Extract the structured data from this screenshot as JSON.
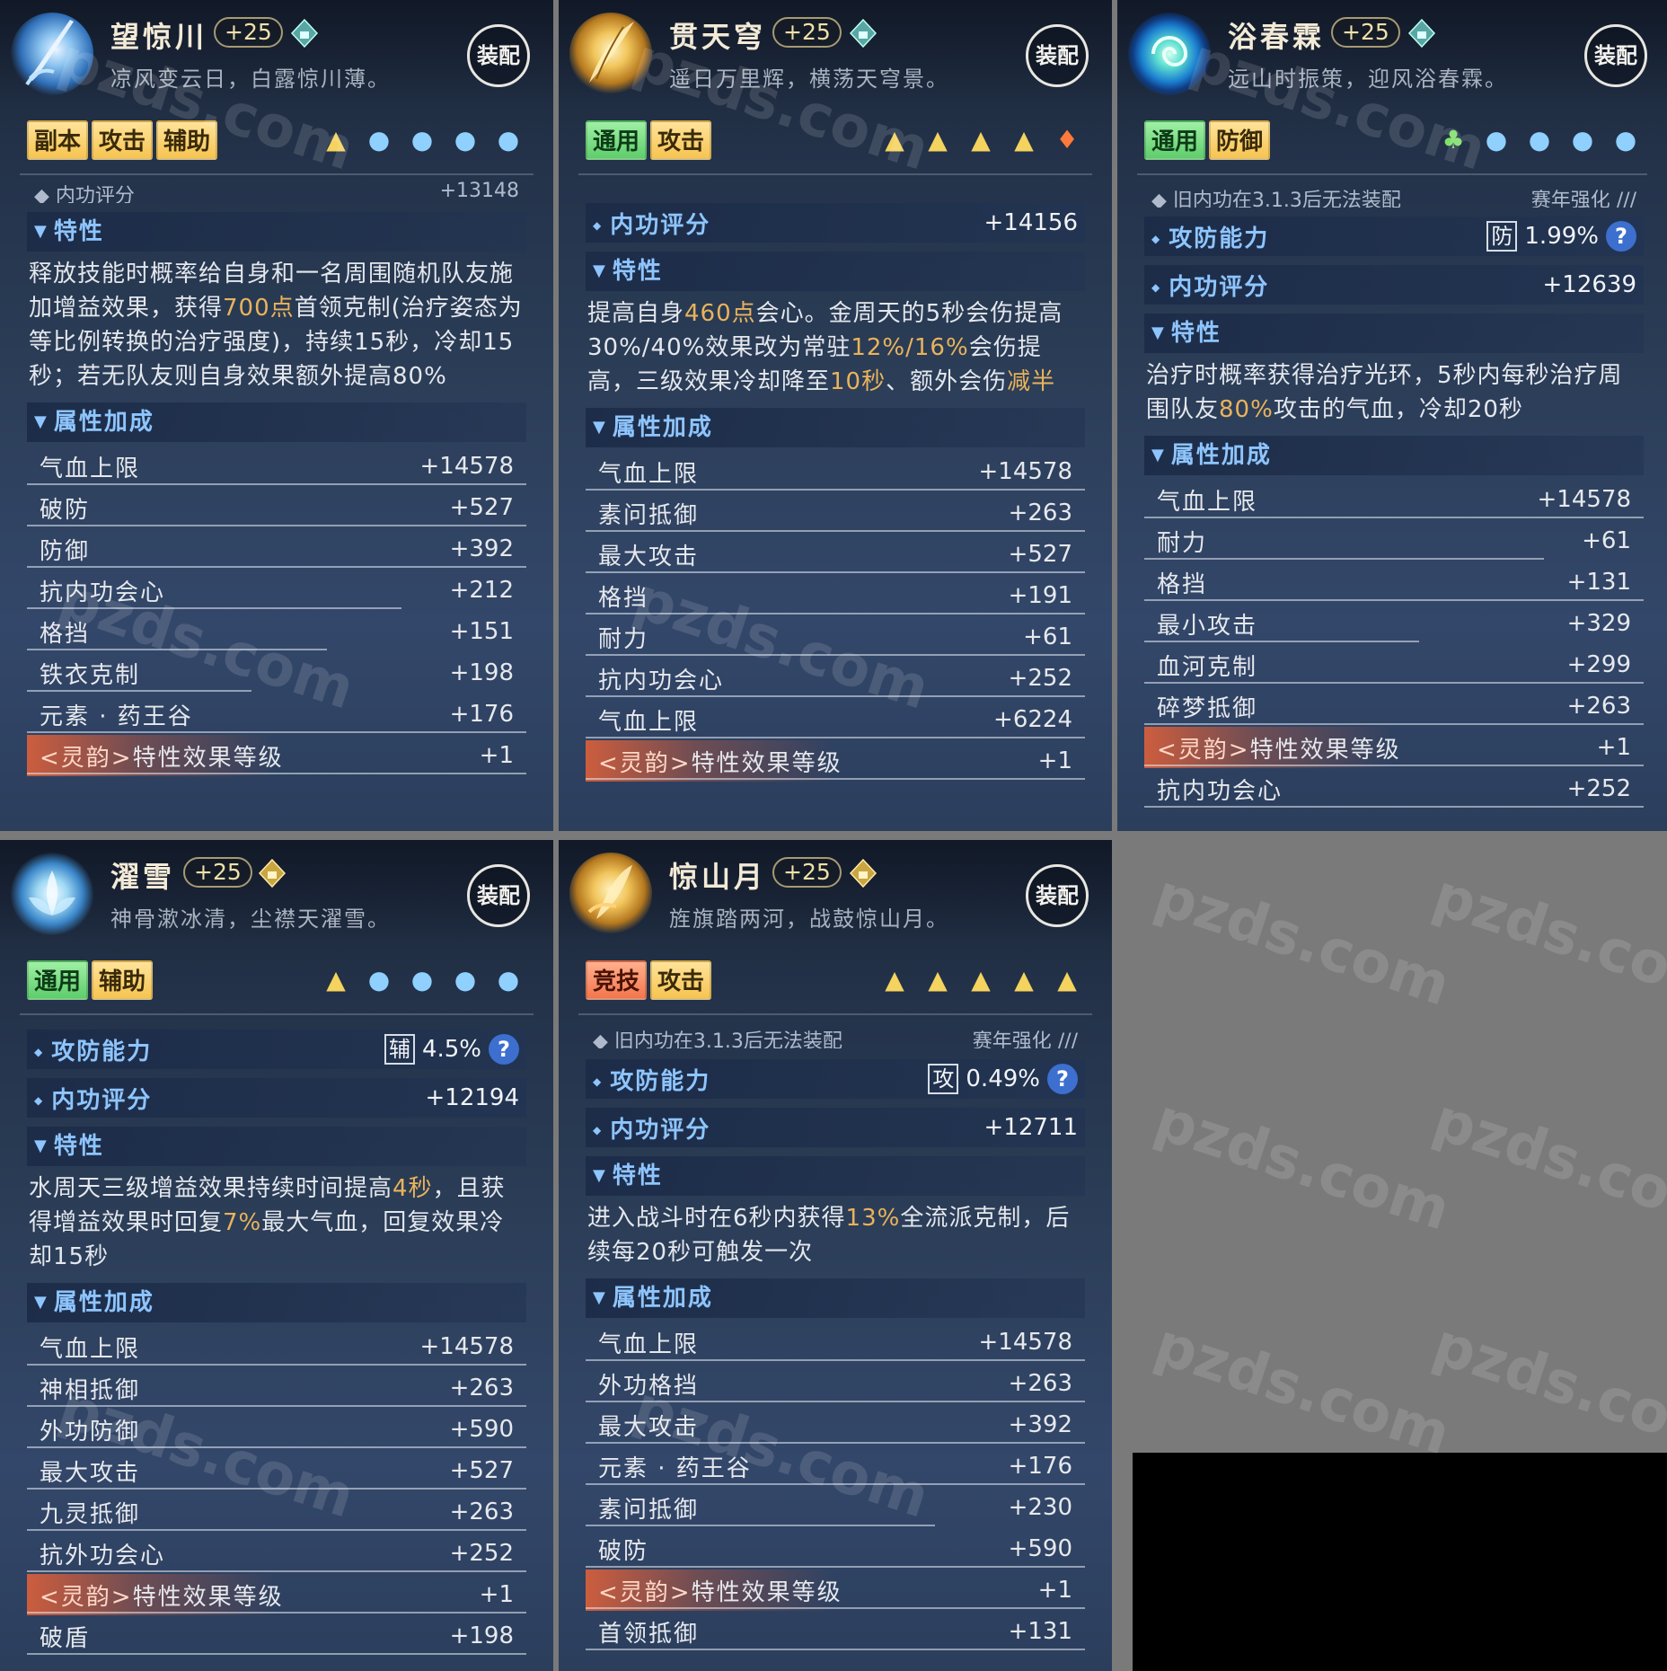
{
  "watermark": "pzds.com",
  "panels": [
    {
      "name": "望惊川",
      "level": "+25",
      "motto": "凉风变云日，白露惊川薄。",
      "equip": "装配",
      "tags": [
        "副本",
        "攻击",
        "辅助"
      ],
      "cut_left": "◆ 内功评分",
      "cut_right": "+13148",
      "trait_title": "特性",
      "desc": [
        "释放技能时概率给自身和一名周围随机队友施加增益效果，获得",
        "700点",
        "首领克制(治疗姿态为等比例转换的治疗强度)，持续15秒，冷却15秒；若无队友则自身效果额外提高80%"
      ],
      "attr_title": "属性加成",
      "stats": [
        {
          "k": "气血上限",
          "v": "+14578"
        },
        {
          "k": "破防",
          "v": "+527"
        },
        {
          "k": "防御",
          "v": "+392"
        },
        {
          "k": "抗内功会心",
          "v": "+212"
        },
        {
          "k": "格挡",
          "v": "+151"
        },
        {
          "k": "铁衣克制",
          "v": "+198"
        },
        {
          "k": "元素 · 药王谷",
          "v": "+176"
        },
        {
          "k": "<灵韵>特性效果等级",
          "lt": "<灵韵>",
          "rest": "特性效果等级",
          "v": "+1"
        }
      ]
    },
    {
      "name": "贯天穹",
      "level": "+25",
      "motto": "遥日万里辉，横荡天穹景。",
      "equip": "装配",
      "tags": [
        "通用",
        "攻击"
      ],
      "score_label": "内功评分",
      "score_value": "+14156",
      "trait_title": "特性",
      "desc": [
        "提高自身",
        "460点",
        "会心。金周天的5秒会伤提高30%/40%效果改为常驻",
        "12%/16%",
        "会伤提高，三级效果冷却降至",
        "10秒",
        "、额外会伤",
        "减半"
      ],
      "attr_title": "属性加成",
      "stats": [
        {
          "k": "气血上限",
          "v": "+14578"
        },
        {
          "k": "素问抵御",
          "v": "+263"
        },
        {
          "k": "最大攻击",
          "v": "+527"
        },
        {
          "k": "格挡",
          "v": "+191"
        },
        {
          "k": "耐力",
          "v": "+61"
        },
        {
          "k": "抗内功会心",
          "v": "+252"
        },
        {
          "k": "气血上限",
          "v": "+6224"
        },
        {
          "lt": "<灵韵>",
          "rest": "特性效果等级",
          "v": "+1"
        }
      ]
    },
    {
      "name": "浴春霖",
      "level": "+25",
      "motto": "远山时振策，迎风浴春霖。",
      "equip": "装配",
      "tags": [
        "通用",
        "防御"
      ],
      "cut_left": "◆ 旧内功在3.1.3后无法装配",
      "cut_right": "赛年强化 ///",
      "power_label": "攻防能力",
      "power_badge": "防",
      "power_value": "1.99%",
      "score_label": "内功评分",
      "score_value": "+12639",
      "trait_title": "特性",
      "desc": [
        "治疗时概率获得治疗光环，5秒内每秒治疗周围队友",
        "80%",
        "攻击的气血，冷却20秒"
      ],
      "attr_title": "属性加成",
      "stats": [
        {
          "k": "气血上限",
          "v": "+14578"
        },
        {
          "k": "耐力",
          "v": "+61"
        },
        {
          "k": "格挡",
          "v": "+131"
        },
        {
          "k": "最小攻击",
          "v": "+329"
        },
        {
          "k": "血河克制",
          "v": "+299"
        },
        {
          "k": "碎梦抵御",
          "v": "+263"
        },
        {
          "lt": "<灵韵>",
          "rest": "特性效果等级",
          "v": "+1"
        },
        {
          "k": "抗内功会心",
          "v": "+252"
        }
      ]
    },
    {
      "name": "濯雪",
      "level": "+25",
      "motto": "神骨漱冰清，尘襟天濯雪。",
      "equip": "装配",
      "tags": [
        "通用",
        "辅助"
      ],
      "power_label": "攻防能力",
      "power_badge": "辅",
      "power_value": "4.5%",
      "score_label": "内功评分",
      "score_value": "+12194",
      "trait_title": "特性",
      "desc": [
        "水周天三级增益效果持续时间提高",
        "4秒",
        "，且获得增益效果时回复",
        "7%",
        "最大气血，回复效果冷却15秒"
      ],
      "attr_title": "属性加成",
      "stats": [
        {
          "k": "气血上限",
          "v": "+14578"
        },
        {
          "k": "神相抵御",
          "v": "+263"
        },
        {
          "k": "外功防御",
          "v": "+590"
        },
        {
          "k": "最大攻击",
          "v": "+527"
        },
        {
          "k": "九灵抵御",
          "v": "+263"
        },
        {
          "k": "抗外功会心",
          "v": "+252"
        },
        {
          "lt": "<灵韵>",
          "rest": "特性效果等级",
          "v": "+1"
        },
        {
          "k": "破盾",
          "v": "+198"
        }
      ]
    },
    {
      "name": "惊山月",
      "level": "+25",
      "motto": "旌旗踏两河，战鼓惊山月。",
      "equip": "装配",
      "tags": [
        "竞技",
        "攻击"
      ],
      "cut_left": "◆ 旧内功在3.1.3后无法装配",
      "cut_right": "赛年强化 ///",
      "power_label": "攻防能力",
      "power_badge": "攻",
      "power_value": "0.49%",
      "score_label": "内功评分",
      "score_value": "+12711",
      "trait_title": "特性",
      "desc": [
        "进入战斗时在6秒内获得",
        "13%",
        "全流派克制，后续每20秒可触发一次"
      ],
      "attr_title": "属性加成",
      "stats": [
        {
          "k": "气血上限",
          "v": "+14578"
        },
        {
          "k": "外功格挡",
          "v": "+263"
        },
        {
          "k": "最大攻击",
          "v": "+392"
        },
        {
          "k": "元素 · 药王谷",
          "v": "+176"
        },
        {
          "k": "素问抵御",
          "v": "+230"
        },
        {
          "k": "破防",
          "v": "+590"
        },
        {
          "lt": "<灵韵>",
          "rest": "特性效果等级",
          "v": "+1"
        },
        {
          "k": "首领抵御",
          "v": "+131"
        }
      ]
    }
  ]
}
